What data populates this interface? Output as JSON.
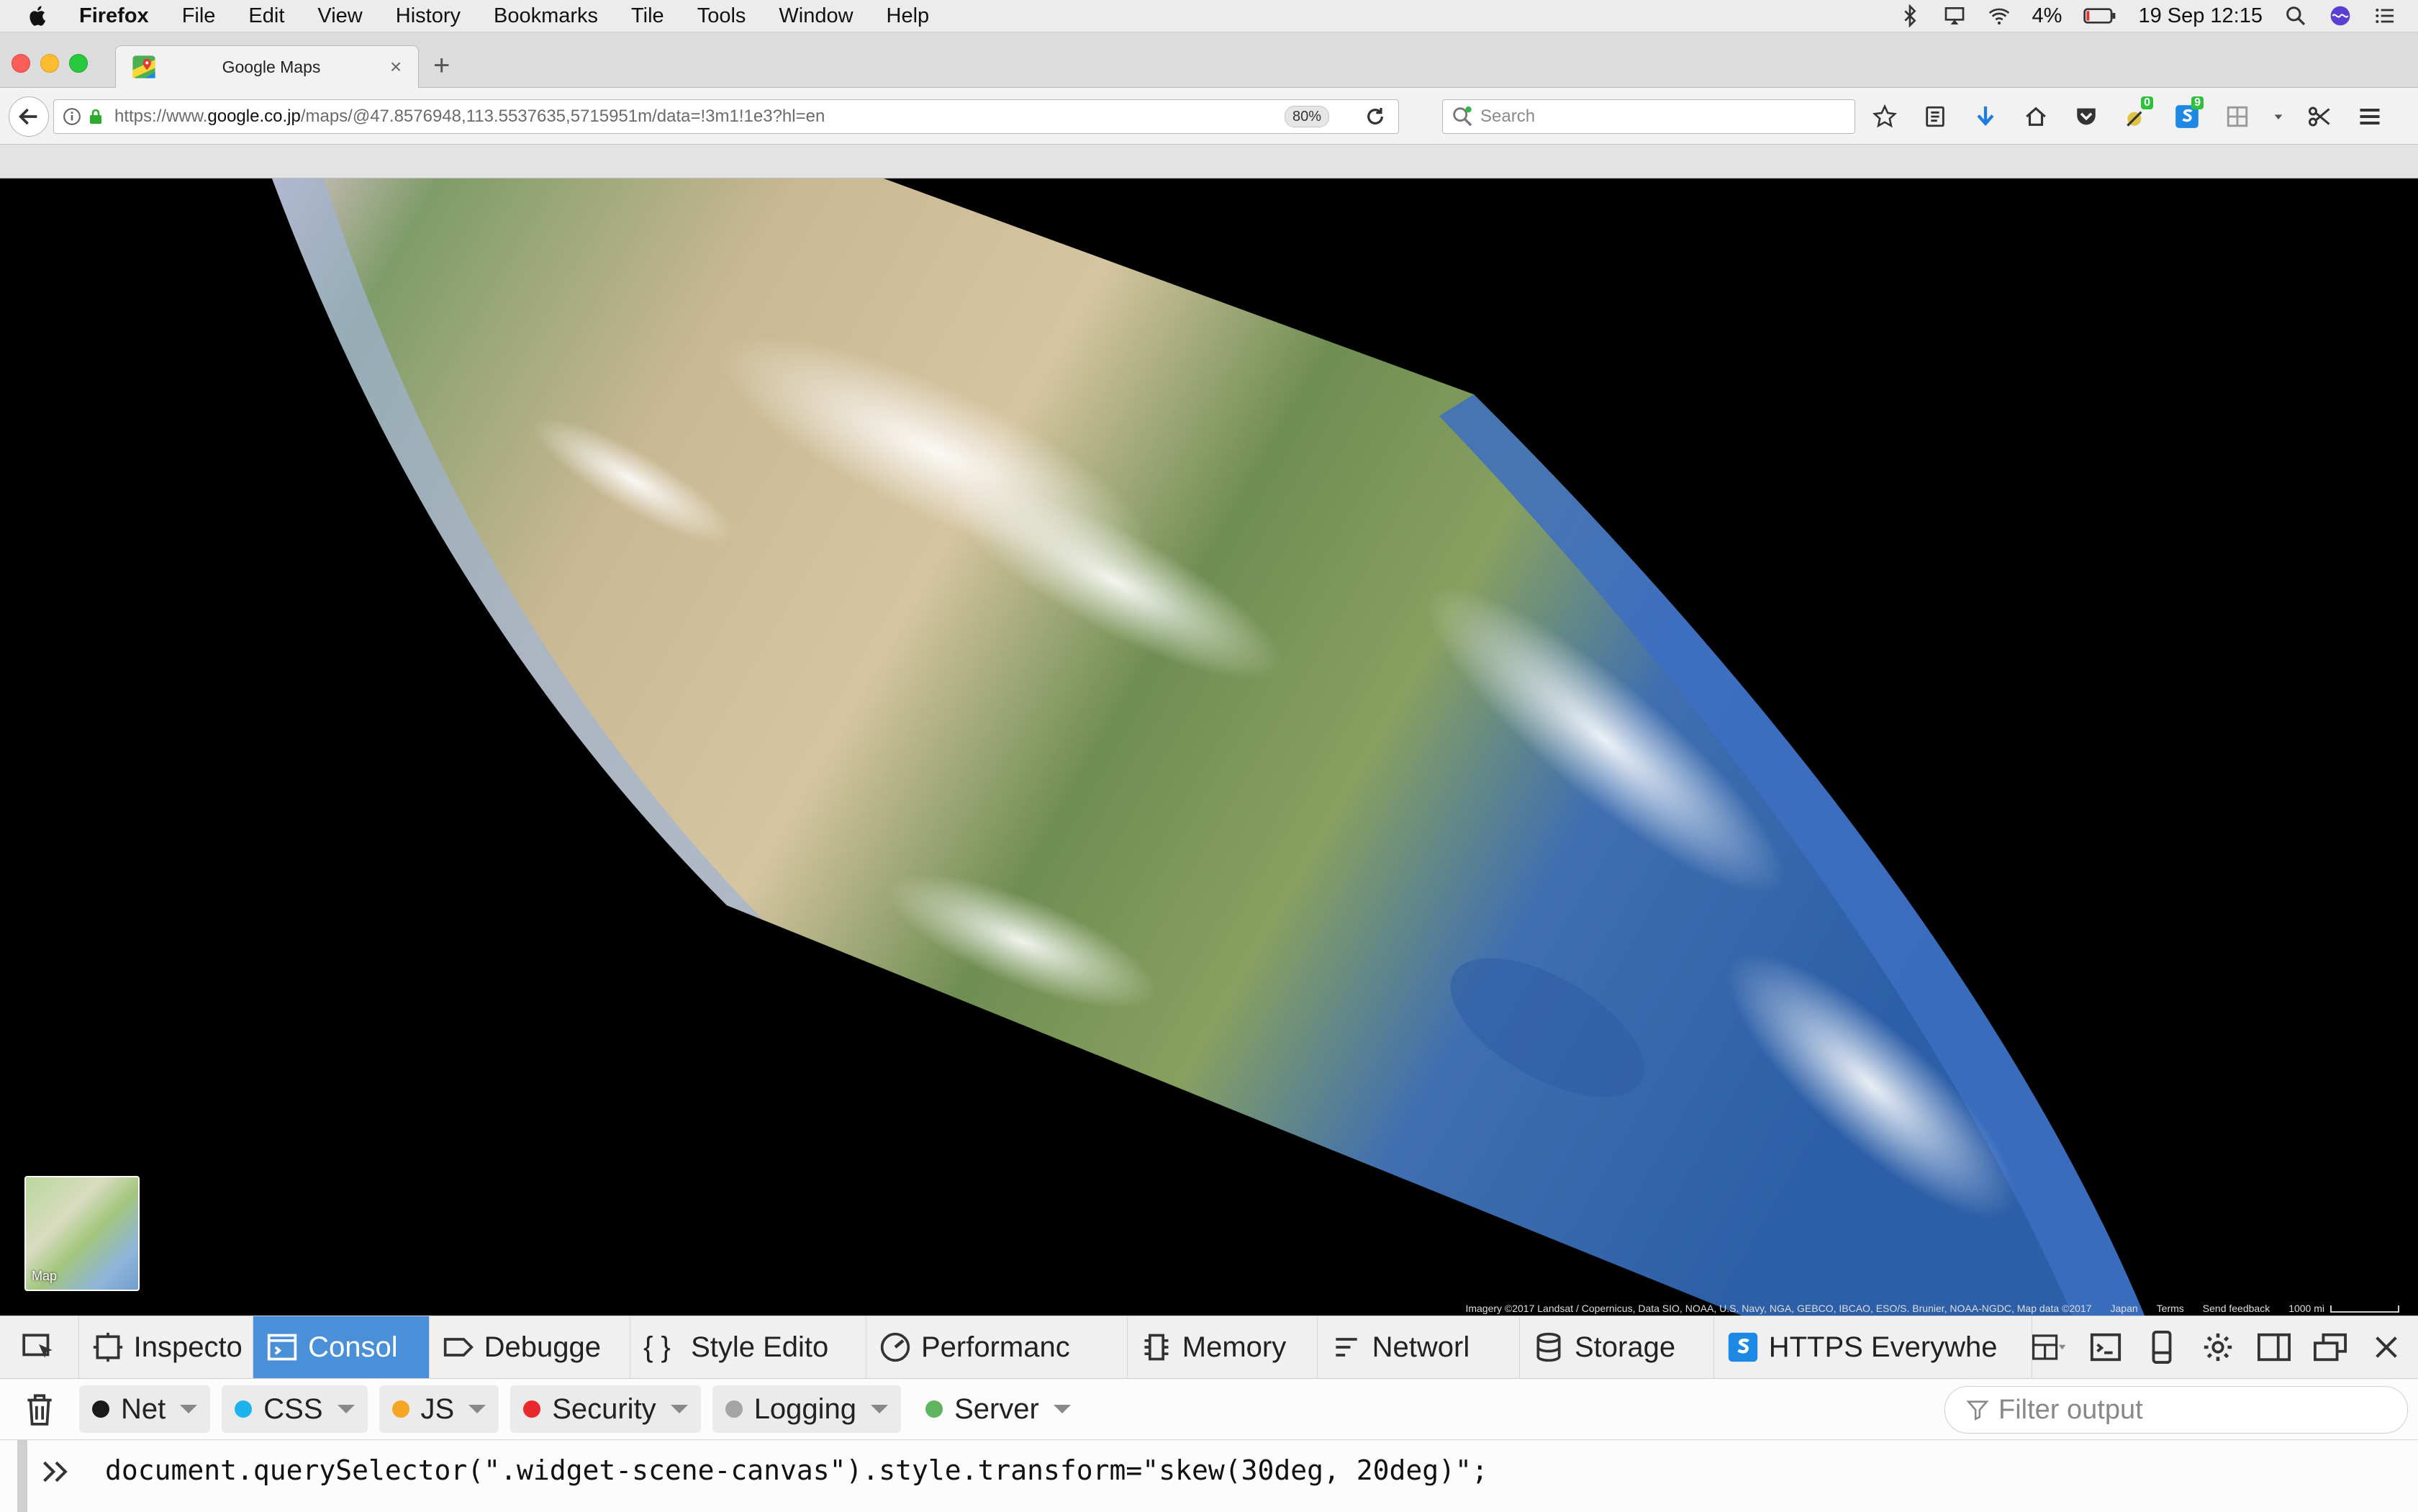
{
  "menubar": {
    "app_name": "Firefox",
    "items": [
      "File",
      "Edit",
      "View",
      "History",
      "Bookmarks",
      "Tile",
      "Tools",
      "Window",
      "Help"
    ],
    "battery": "4%",
    "datetime": "19 Sep  12:15"
  },
  "tab": {
    "title": "Google Maps",
    "close": "×",
    "new_tab": "+"
  },
  "urlbar": {
    "url_prefix": "https://www.",
    "url_domain": "google.co.jp",
    "url_path": "/maps/@47.8576948,113.5537635,5715951m/data=!3m1!1e3?hl=en",
    "zoom": "80%"
  },
  "searchbar": {
    "placeholder": "Search"
  },
  "toolbar": {
    "badge_a": "0",
    "badge_b": "9"
  },
  "map": {
    "minimap_label": "Map",
    "attribution": "Imagery ©2017 Landsat / Copernicus, Data SIO, NOAA, U.S. Navy, NGA, GEBCO, IBCAO, ESO/S. Brunier, NOAA-NGDC, Map data ©2017",
    "region": "Japan",
    "terms": "Terms",
    "feedback": "Send feedback",
    "scale": "1000 mi"
  },
  "devtools": {
    "tabs": [
      "Inspecto",
      "Consol",
      "Debugge",
      "Style Edito",
      "Performanc",
      "Memory",
      "Networl",
      "Storage",
      "HTTPS Everywhe"
    ],
    "active_tab": 1,
    "filters": [
      {
        "label": "Net",
        "color": "#1a1a1a"
      },
      {
        "label": "CSS",
        "color": "#1eb3ec"
      },
      {
        "label": "JS",
        "color": "#f5a623"
      },
      {
        "label": "Security",
        "color": "#e9292e"
      },
      {
        "label": "Logging",
        "color": "#a5a5a5"
      },
      {
        "label": "Server",
        "color": "#5fb55f"
      }
    ],
    "filter_placeholder": "Filter output",
    "command": "document.querySelector(\".widget-scene-canvas\").style.transform=\"skew(30deg, 20deg)\";"
  },
  "colors": {
    "active_tab": "#4a90d9",
    "menubar_bg": "#ececec"
  }
}
